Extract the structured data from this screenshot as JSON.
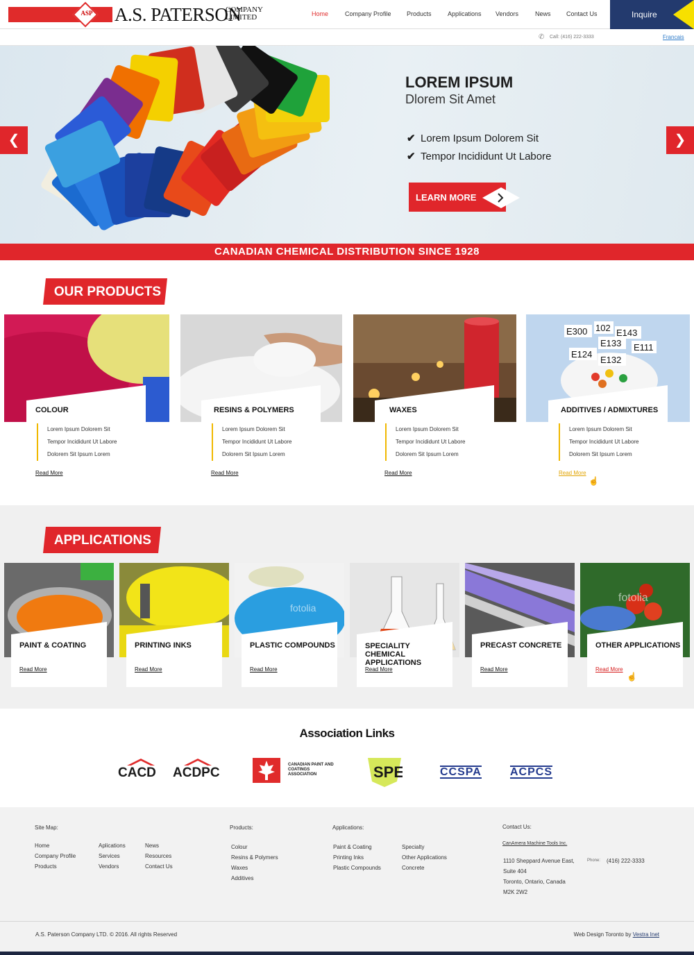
{
  "header": {
    "logo_mark": "ASP",
    "logo_name": "A.S. PATERSON",
    "logo_sub_1": "COMPANY",
    "logo_sub_2": "LIMITED",
    "nav": [
      "Home",
      "Company Profile",
      "Products",
      "Applications",
      "Vendors",
      "News",
      "Contact Us"
    ],
    "active_nav": "Home",
    "inquire": "Inquire",
    "call": "Call: (416) 222-3333",
    "language": "Francais"
  },
  "hero": {
    "title": "LOREM IPSUM",
    "subtitle": "Dlorem Sit Amet",
    "checks": [
      "Lorem Ipsum Dolorem Sit",
      "Tempor Incididunt Ut Labore"
    ],
    "cta": "LEARN MORE",
    "prev_icon": "chevron-left-icon",
    "next_icon": "chevron-right-icon"
  },
  "banner": "CANADIAN CHEMICAL DISTRIBUTION SINCE 1928",
  "products": {
    "heading": "OUR PRODUCTS",
    "items": [
      {
        "title": "COLOUR",
        "lines": [
          "Lorem Ipsum Dolorem Sit",
          "Tempor Incididunt Ut Labore",
          "Dolorem Sit  Ipsum Lorem"
        ],
        "read_more": "Read More"
      },
      {
        "title": "RESINS & POLYMERS",
        "lines": [
          "Lorem Ipsum Dolorem Sit",
          "Tempor Incididunt Ut Labore",
          "Dolorem Sit  Ipsum Lorem"
        ],
        "read_more": "Read More"
      },
      {
        "title": "WAXES",
        "lines": [
          "Lorem Ipsum Dolorem Sit",
          "Tempor Incididunt Ut Labore",
          "Dolorem Sit  Ipsum Lorem"
        ],
        "read_more": "Read More"
      },
      {
        "title": "ADDITIVES / ADMIXTURES",
        "lines": [
          "Lorem Ipsum Dolorem Sit",
          "Tempor Incididunt Ut Labore",
          "Dolorem Sit  Ipsum Lorem"
        ],
        "read_more": "Read More"
      }
    ],
    "additive_codes": [
      "E300",
      "102",
      "E143",
      "E133",
      "E111",
      "E124",
      "E132"
    ]
  },
  "applications": {
    "heading": "APPLICATIONS",
    "items": [
      {
        "title": "PAINT & COATING",
        "read_more": "Read More"
      },
      {
        "title": "PRINTING INKS",
        "read_more": "Read More"
      },
      {
        "title": "PLASTIC COMPOUNDS",
        "read_more": "Read More"
      },
      {
        "title": "SPECIALITY CHEMICAL APPLICATIONS",
        "read_more": "Read More"
      },
      {
        "title": "PRECAST CONCRETE",
        "read_more": "Read More"
      },
      {
        "title": "OTHER APPLICATIONS",
        "read_more": "Read More"
      }
    ],
    "watermark": "fotolia"
  },
  "association": {
    "title": "Association Links",
    "logos": [
      "CACD",
      "ACDPC",
      "CANADIAN PAINT AND COATINGS ASSOCIATION",
      "SPE",
      "CCSPA",
      "ACPCS"
    ]
  },
  "footer": {
    "sitemap_head": "Site Map:",
    "sitemap_col1": [
      "Home",
      "Company Profile",
      "Products"
    ],
    "sitemap_col2": [
      "Aplications",
      "Services",
      "Vendors"
    ],
    "sitemap_col3": [
      "News",
      "Resources",
      "Contact Us"
    ],
    "products_head": "Products:",
    "products": [
      "Colour",
      "Resins & Polymers",
      "Waxes",
      "Additives"
    ],
    "applications_head": "Applications:",
    "applications_col1": [
      "Paint & Coating",
      "Printing Inks",
      "Plastic Compounds"
    ],
    "applications_col2": [
      "Specialty",
      "Other Applications",
      "Concrete"
    ],
    "contact_head": "Contact Us:",
    "company": "CanAmera Machine Tools Inc.",
    "address": [
      "1110 Sheppard Avenue East,",
      "Suite 404",
      "Toronto, Ontario, Canada",
      "M2K 2W2"
    ],
    "phone_label": "Phone:",
    "phone": "(416) 222-3333",
    "copyright": "A.S. Paterson Company LTD. © 2016.  All rights Reserved",
    "credit_text": "Web Design Toronto by ",
    "credit_link": "Vestra Inet"
  },
  "colors": {
    "brand_red": "#e0262b",
    "navy": "#233a6e",
    "accent_yellow": "#f7e000",
    "bar_yellow": "#f0b800"
  }
}
